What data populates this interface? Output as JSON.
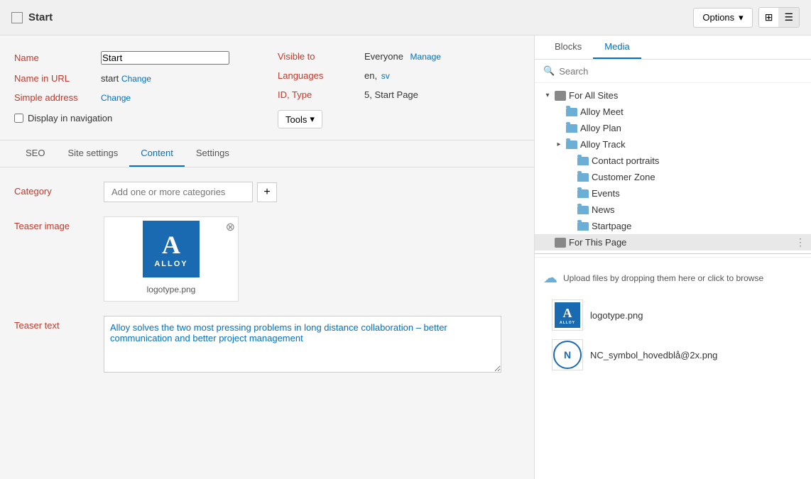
{
  "topBar": {
    "pageIcon": "page-icon",
    "title": "Start",
    "optionsLabel": "Options",
    "viewGrid": "⊞",
    "viewList": "☰"
  },
  "meta": {
    "nameLabel": "Name",
    "nameValue": "Start",
    "visibleToLabel": "Visible to",
    "visibleToValue": "Everyone",
    "manageLabel": "Manage",
    "nameInUrlLabel": "Name in URL",
    "nameInUrlValue": "start",
    "changeLabel": "Change",
    "languagesLabel": "Languages",
    "languagesValue": "en,",
    "languagesSv": "sv",
    "simpleAddressLabel": "Simple address",
    "simpleAddressChange": "Change",
    "idTypeLabel": "ID, Type",
    "idTypeValue": "5, Start Page",
    "displayInNav": "Display in navigation",
    "toolsLabel": "Tools"
  },
  "tabs": {
    "items": [
      {
        "label": "SEO"
      },
      {
        "label": "Site settings"
      },
      {
        "label": "Content"
      },
      {
        "label": "Settings"
      }
    ],
    "activeIndex": 2
  },
  "content": {
    "categoryLabel": "Category",
    "categoryPlaceholder": "Add one or more categories",
    "addButtonLabel": "+",
    "teaserImageLabel": "Teaser image",
    "imageFilename": "logotype.png",
    "teaserTextLabel": "Teaser text",
    "teaserTextValue": "Alloy solves the two most pressing problems in long distance collaboration – better communication and better project management"
  },
  "rightPanel": {
    "tabs": [
      {
        "label": "Blocks"
      },
      {
        "label": "Media"
      }
    ],
    "activeTab": 1,
    "searchPlaceholder": "Search",
    "tree": {
      "root": {
        "label": "For All Sites",
        "expanded": true,
        "children": [
          {
            "label": "Alloy Meet",
            "indent": 1
          },
          {
            "label": "Alloy Plan",
            "indent": 1
          },
          {
            "label": "Alloy Track",
            "indent": 1,
            "expandable": true
          },
          {
            "label": "Contact portraits",
            "indent": 2
          },
          {
            "label": "Customer Zone",
            "indent": 2
          },
          {
            "label": "Events",
            "indent": 2
          },
          {
            "label": "News",
            "indent": 2
          },
          {
            "label": "Startpage",
            "indent": 2
          }
        ]
      },
      "forThisPage": {
        "label": "For This Page",
        "selected": true
      }
    },
    "uploadText": "Upload files by dropping them here or click to browse",
    "mediaItems": [
      {
        "name": "logotype.png",
        "type": "alloy"
      },
      {
        "name": "NC_symbol_hovedblå@2x.png",
        "type": "nc"
      }
    ]
  }
}
